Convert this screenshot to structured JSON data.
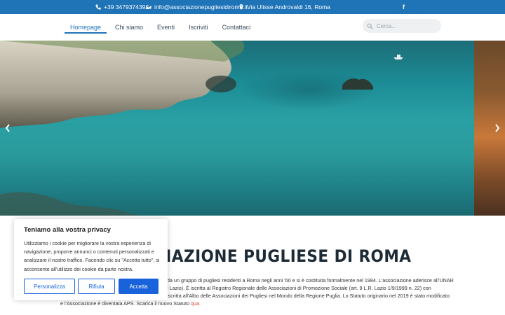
{
  "topbar": {
    "phone": "+39 3479374392",
    "email": "info@associazionepugliesidiroma.it",
    "address": "Via Ulisse Androvaldi 16, Roma",
    "social": "f"
  },
  "nav": {
    "items": [
      {
        "label": "Homepage",
        "active": true
      },
      {
        "label": "Chi siamo"
      },
      {
        "label": "Eventi"
      },
      {
        "label": "Iscriviti"
      },
      {
        "label": "Contattaci"
      }
    ],
    "search_placeholder": "Cerca..."
  },
  "content": {
    "title": "CIAZIONE PUGLIESE DI ROMA",
    "line1": "da un gruppo di pugliesi residenti a Roma negli anni '60 e si è costituita formalmente nel 1984. L'associazione aderisce all'UNAR",
    "line2": "l Lazio). È iscritta al Registro Regionale delle Associazioni di Promozione Sociale (art. 9 L.R. Lazio 1/9/1999 n. 22) con",
    "line3": "iscritta all'Albo delle Associazioni dei Pugliesi nel Mondo della Regione Puglia. Lo Statuto originario nel 2019 è stato modificato",
    "line4": "e l'Associazione è diventata APS. Scarica il nuovo Statuto ",
    "line4_link": "qua."
  },
  "cookie": {
    "title": "Teniamo alla vostra privacy",
    "body": "Utilizziamo i cookie per migliorare la vostra esperienza di navigazione, proporre annunci o contenuti personalizzati e analizzare il nostro traffico. Facendo clic su \"Accetta tutto\", si acconsente all'utilizzo dei cookie da parte nostra.",
    "buttons": {
      "customize": "Personalizza",
      "reject": "Rifiuta",
      "accept": "Accetta"
    }
  },
  "colors": {
    "brand": "#1f73b7",
    "cookie_button": "#1863dc"
  }
}
